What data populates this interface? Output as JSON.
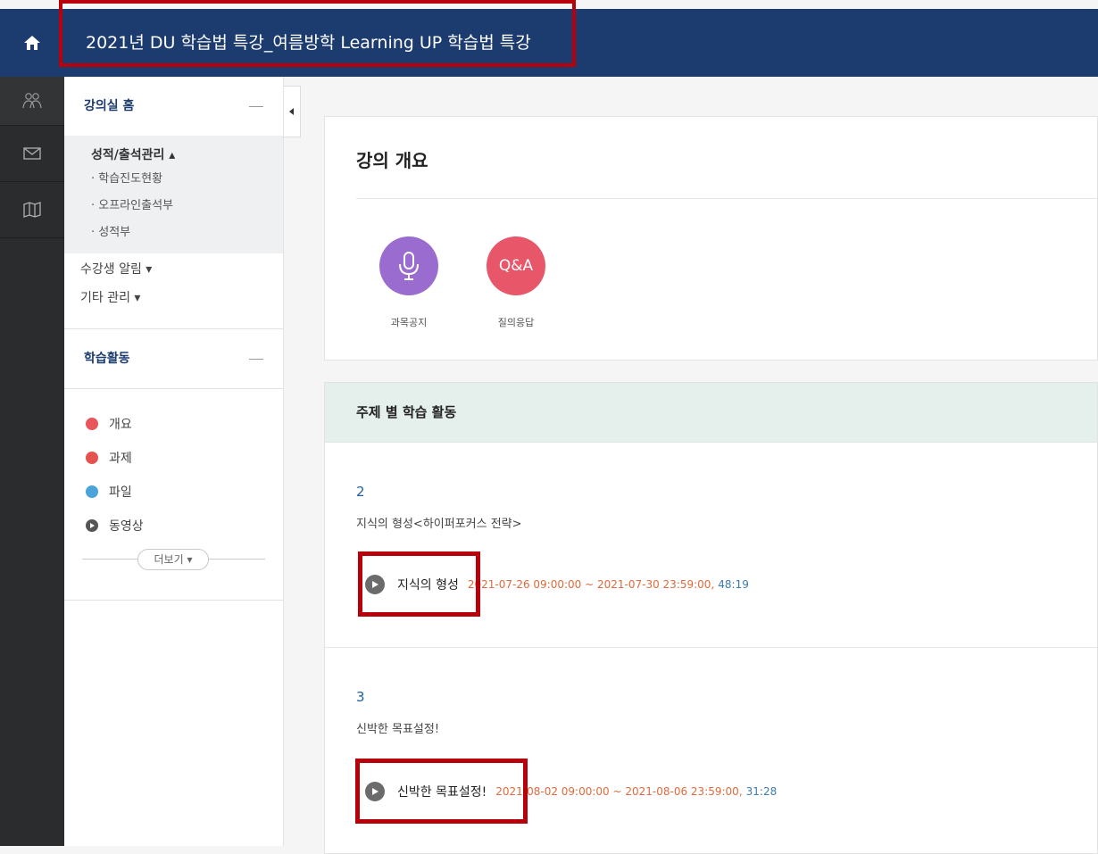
{
  "header": {
    "course_title": "2021년 DU 학습법 특강_여름방학 Learning UP 학습법 특강"
  },
  "iconbar": [
    "home-icon",
    "people-icon",
    "mail-icon",
    "map-icon"
  ],
  "sidebar": {
    "section1_title": "강의실 홈",
    "grade_title": "성적/출석관리 ▴",
    "grade_items": [
      "· 학습진도현황",
      "· 오프라인출석부",
      "· 성적부"
    ],
    "student_alert": "수강생 알림 ▾",
    "other_manage": "기타 관리 ▾",
    "section2_title": "학습활동",
    "activities": [
      {
        "label": "개요",
        "color": "#e8565c"
      },
      {
        "label": "과제",
        "color": "#e4534f"
      },
      {
        "label": "파일",
        "color": "#4aa3d9"
      },
      {
        "label": "동영상",
        "color": "#555555"
      }
    ],
    "more_label": "더보기 ▾"
  },
  "overview": {
    "title": "강의 개요",
    "icons": [
      {
        "label": "과목공지",
        "color": "#9b6ccf",
        "icon": "microphone-icon"
      },
      {
        "label": "질의응답",
        "color": "#e8566a",
        "text": "Q&A"
      }
    ]
  },
  "topics": {
    "header": "주제 별 학습 활동",
    "sections": [
      {
        "number": "2",
        "description": "지식의 형성<하이퍼포커스 전략>",
        "video_title": "지식의 형성",
        "period": "2021-07-26 09:00:00 ~ 2021-07-30 23:59:00,",
        "duration": "48:19"
      },
      {
        "number": "3",
        "description": "신박한 목표설정!",
        "video_title": "신박한 목표설정!",
        "period": "2021-08-02 09:00:00 ~ 2021-08-06 23:59:00,",
        "duration": "31:28"
      }
    ]
  }
}
